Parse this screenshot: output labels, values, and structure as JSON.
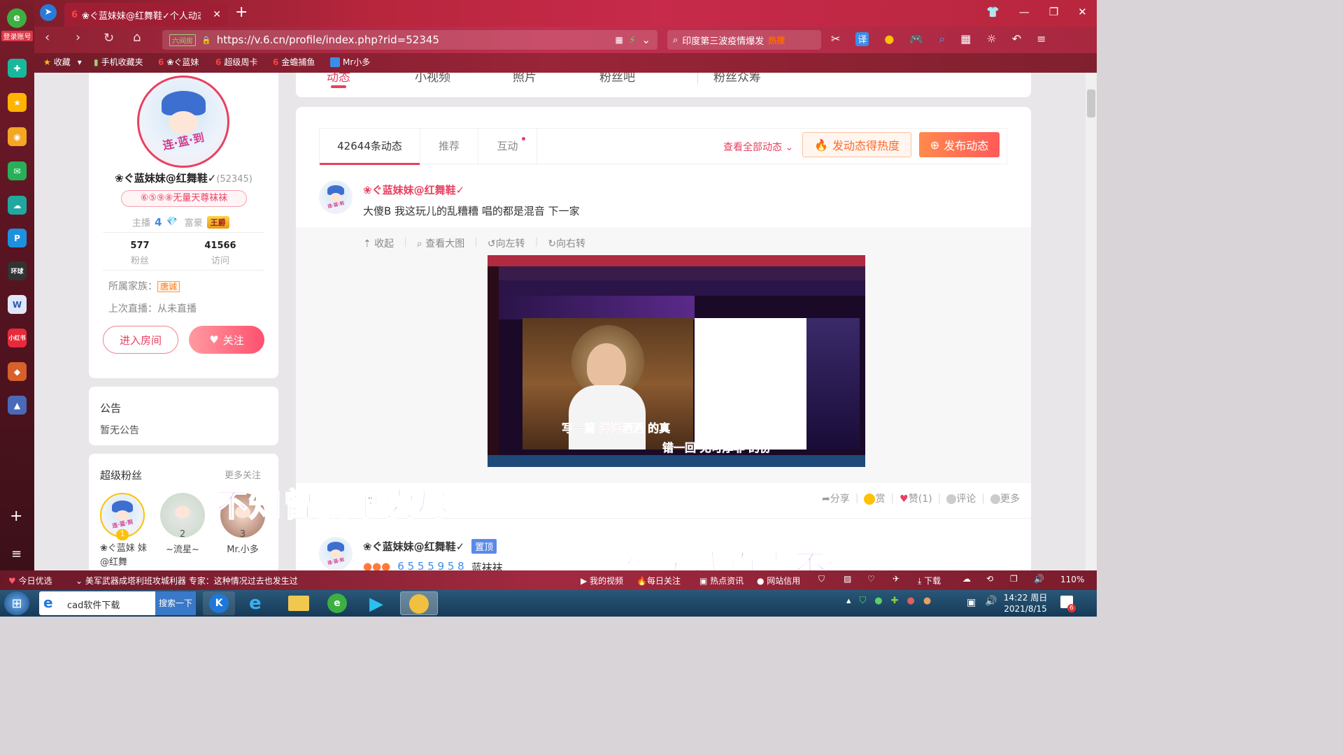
{
  "browser": {
    "tab_title": "❀ぐ蓝妹妹@红舞鞋✓个人动态",
    "new_tab": "+",
    "login_label": "登录账号",
    "url": "https://v.6.cn/profile/index.php?rid=52345",
    "url_tag": "六间房",
    "search_text": "印度第三波疫情爆发",
    "search_hot": "热搜",
    "translate_icon": "译",
    "favorites": [
      {
        "label": "收藏"
      },
      {
        "label": "手机收藏夹"
      },
      {
        "label": "❀ぐ蓝妹"
      },
      {
        "label": "超级周卡"
      },
      {
        "label": "金蟾捕鱼"
      },
      {
        "label": "Mr小多"
      }
    ]
  },
  "page": {
    "nav_tabs": [
      "动态",
      "小视频",
      "照片",
      "粉丝吧",
      "粉丝众筹"
    ],
    "profile": {
      "name": "❀ぐ蓝妹妹@红舞鞋✓",
      "id": "(52345)",
      "badge": "⑥⑤⑨⑧无量天尊袜袜",
      "anchor_label": "主播",
      "anchor_level": "4",
      "rich_label": "富豪",
      "rich_level": "王爵",
      "fans_count": "577",
      "fans_label": "粉丝",
      "visits_count": "41566",
      "visits_label": "访问",
      "family_label": "所属家族：",
      "family_value": "唐诚",
      "last_live": "上次直播：从未直播",
      "enter_room": "进入房间",
      "follow": "关注"
    },
    "notice": {
      "title": "公告",
      "text": "暂无公告"
    },
    "super_fans": {
      "title": "超级粉丝",
      "more": "更多关注",
      "fans": [
        {
          "rank": "1",
          "name": "❀ぐ蓝妹 妹@红舞"
        },
        {
          "rank": "2",
          "name": "~流星~"
        },
        {
          "rank": "3",
          "name": "Mr.小多"
        }
      ]
    },
    "feed": {
      "tabs": [
        "42644条动态",
        "推荐",
        "互动"
      ],
      "view_all": "查看全部动态",
      "hot_btn": "发动态得热度",
      "publish_btn": "发布动态",
      "post1": {
        "author": "❀ぐ蓝妹妹@红舞鞋✓",
        "text": "大傻B 我这玩儿的乱糟糟 唱的都是混音 下一家",
        "actions": [
          "收起",
          "查看大图",
          "向左转",
          "向右转"
        ],
        "footer_prefix": "网",
        "share": "分享",
        "reward": "赏",
        "like": "赞(1)",
        "comment": "评论",
        "more": "更多"
      },
      "post2": {
        "author": "❀ぐ蓝妹妹@红舞鞋✓",
        "pin": "置顶",
        "partial": "6 5 5 5 9 5 8",
        "partial2": "蓝袜袜"
      }
    },
    "video_subtitles": [
      "写一篇 洋洋洒洒 的真",
      "错一回 无可厚非 的份"
    ]
  },
  "overlays": [
    "不知曾孤单尝尽",
    "你笑我百毒不侵"
  ],
  "statusbar": {
    "today": "今日优选",
    "news": "美军武器成塔利班攻城利器 专家：这种情况过去也发生过",
    "items": [
      "我的视频",
      "每日关注",
      "热点资讯",
      "网站信用"
    ],
    "download": "下载",
    "zoom": "110%"
  },
  "taskbar": {
    "ie_item": "cad软件下载",
    "search_btn": "搜索一下",
    "time": "14:22 周日",
    "date": "2021/8/15",
    "notif": "6"
  }
}
